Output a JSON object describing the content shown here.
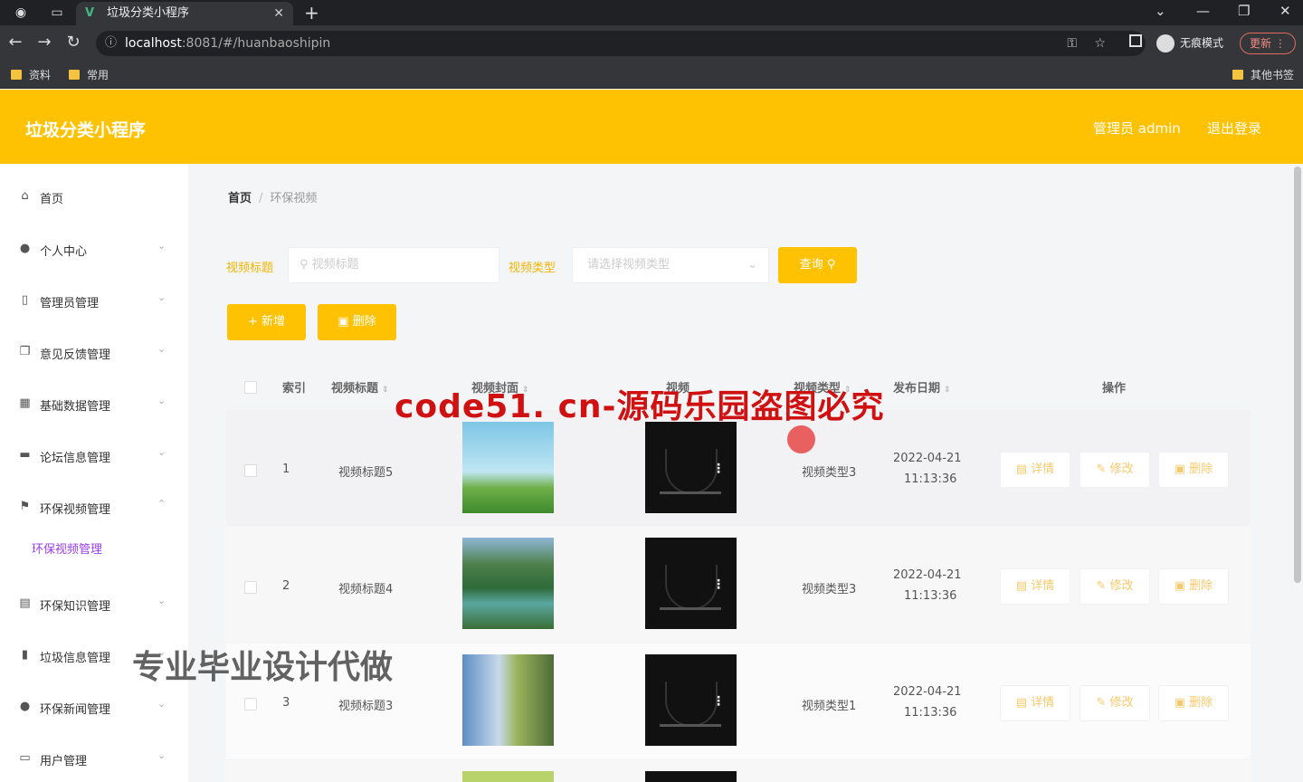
{
  "browser": {
    "tab_title": "垃圾分类小程序",
    "url_host": "localhost",
    "url_rest": ":8081/#/huanbaoshipin",
    "incognito_label": "无痕模式",
    "update_label": "更新",
    "bookmarks": [
      "资料",
      "常用"
    ],
    "other_bookmarks": "其他书签"
  },
  "header": {
    "title": "垃圾分类小程序",
    "admin_label": "管理员 admin",
    "logout_label": "退出登录"
  },
  "sidebar": {
    "items": [
      {
        "label": "首页",
        "icon": "home-icon"
      },
      {
        "label": "个人中心",
        "icon": "user-icon"
      },
      {
        "label": "管理员管理",
        "icon": "phone-icon"
      },
      {
        "label": "意见反馈管理",
        "icon": "copy-icon"
      },
      {
        "label": "基础数据管理",
        "icon": "grid-icon"
      },
      {
        "label": "论坛信息管理",
        "icon": "monitor-icon"
      },
      {
        "label": "环保视频管理",
        "icon": "flag-icon"
      },
      {
        "label": "环保知识管理",
        "icon": "list-icon"
      },
      {
        "label": "垃圾信息管理",
        "icon": "chart-icon"
      },
      {
        "label": "环保新闻管理",
        "icon": "bulb-icon"
      },
      {
        "label": "用户管理",
        "icon": "chat-icon"
      }
    ],
    "active_sub": "环保视频管理"
  },
  "breadcrumb": {
    "home": "首页",
    "current": "环保视频"
  },
  "filter": {
    "title_label": "视频标题",
    "title_placeholder": "视频标题",
    "type_label": "视频类型",
    "type_placeholder": "请选择视频类型",
    "search_button": "查询"
  },
  "actions": {
    "add": "+ 新增",
    "delete": "删除"
  },
  "table": {
    "headers": [
      "索引",
      "视频标题",
      "视频封面",
      "视频",
      "视频类型",
      "发布日期",
      "操作"
    ],
    "rows": [
      {
        "index": "1",
        "title": "视频标题5",
        "type": "视频类型3",
        "date": "2022-04-21",
        "time": "11:13:36"
      },
      {
        "index": "2",
        "title": "视频标题4",
        "type": "视频类型3",
        "date": "2022-04-21",
        "time": "11:13:36"
      },
      {
        "index": "3",
        "title": "视频标题3",
        "type": "视频类型1",
        "date": "2022-04-21",
        "time": "11:13:36"
      }
    ],
    "row_actions": {
      "detail": "详情",
      "edit": "修改",
      "delete": "删除"
    }
  },
  "watermarks": {
    "main": "code51. cn-源码乐园盗图必究",
    "side": "专业毕业设计代做"
  },
  "colors": {
    "accent": "#fec202",
    "active_sub": "#9a3ff0"
  }
}
